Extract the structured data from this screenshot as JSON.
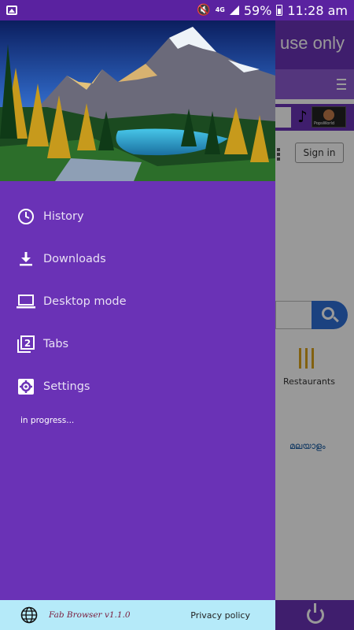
{
  "status_bar": {
    "network": "4G",
    "battery": "59%",
    "time": "11:28 am"
  },
  "background_page": {
    "header_text": "use only",
    "sign_in": "Sign in",
    "category_label": "Restaurants",
    "language_label": "മലയാളം",
    "thumbnail_label": "PopsWorld"
  },
  "drawer": {
    "menu": [
      {
        "label": "History",
        "icon": "clock-icon"
      },
      {
        "label": "Downloads",
        "icon": "download-icon"
      },
      {
        "label": "Desktop mode",
        "icon": "laptop-icon"
      },
      {
        "label": "Tabs",
        "icon": "tabs-icon"
      },
      {
        "label": "Settings",
        "icon": "gear-icon"
      }
    ],
    "progress_text": "in progress...",
    "footer": {
      "app_name": "Fab Browser v1.1.0",
      "privacy": "Privacy policy"
    }
  },
  "colors": {
    "drawer_bg": "#6a32b6",
    "status_bar": "#5a22a0",
    "footer_bg": "#b5eaf9",
    "version_text": "#7a1b3c"
  }
}
